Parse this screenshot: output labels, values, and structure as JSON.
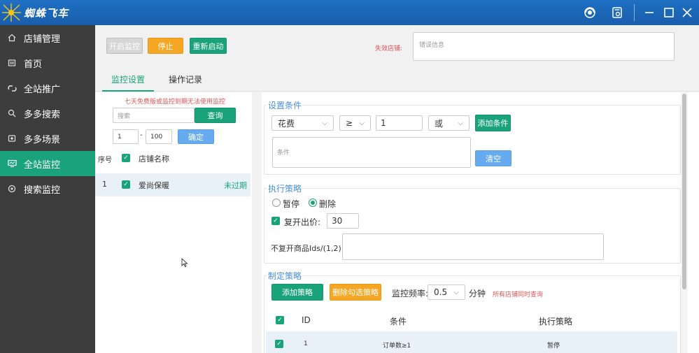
{
  "app": {
    "title": "蜘蛛飞车"
  },
  "sidebar": {
    "items": [
      {
        "label": "店铺管理",
        "icon": "home-icon"
      },
      {
        "label": "首页",
        "icon": "page-icon"
      },
      {
        "label": "全站推广",
        "icon": "link-icon"
      },
      {
        "label": "多多搜索",
        "icon": "search-icon"
      },
      {
        "label": "多多场景",
        "icon": "scene-icon"
      },
      {
        "label": "全站监控",
        "icon": "monitor-icon",
        "active": true
      },
      {
        "label": "搜索监控",
        "icon": "search-monitor-icon"
      }
    ]
  },
  "toolbar": {
    "start_label": "开启监控",
    "stop_label": "停止",
    "restart_label": "重新启动",
    "invalid_store_label": "失效店铺:",
    "error_placeholder": "错误信息"
  },
  "tabs": [
    {
      "label": "监控设置",
      "active": true
    },
    {
      "label": "操作记录",
      "active": false
    }
  ],
  "left": {
    "notice": "七天免费版或监控到期无法使用监控",
    "search_placeholder": "搜索",
    "query_label": "查询",
    "range_from": "1",
    "range_sep": "-",
    "range_to": "100",
    "confirm_label": "确定",
    "columns": {
      "index": "序号",
      "name": "店铺名称"
    },
    "rows": [
      {
        "index": "1",
        "name": "爱尚保暖",
        "status": "未过期"
      }
    ]
  },
  "conditions": {
    "title": "设置条件",
    "field_value": "花费",
    "operator_value": "≥",
    "number_value": "1",
    "logic_value": "或",
    "add_label": "添加条件",
    "textarea_placeholder": "条件",
    "clear_label": "清空"
  },
  "strategy": {
    "title": "执行策略",
    "pause_label": "暂停",
    "delete_label": "删除",
    "reopen_label": "复开出价:",
    "reopen_value": "30",
    "exclude_label": "不复开商品Ids/(1,2)"
  },
  "plan": {
    "title": "制定策略",
    "add_label": "添加策略",
    "delete_selected_label": "删除勾选策略",
    "freq_label": "监控频率:",
    "freq_value": "0.5",
    "freq_unit": "分钟",
    "note": "所有店铺同时查询",
    "columns": {
      "id": "ID",
      "condition": "条件",
      "action": "执行策略"
    },
    "rows": [
      {
        "id": "1",
        "condition": "订单数≥1",
        "action": "暂停"
      }
    ]
  },
  "colors": {
    "titlebar": "#1a5eab",
    "sidebar": "#3d3d3d",
    "accent": "#1aa37a",
    "orange": "#f5a623",
    "blue": "#66aaf0",
    "red": "#e05555"
  }
}
